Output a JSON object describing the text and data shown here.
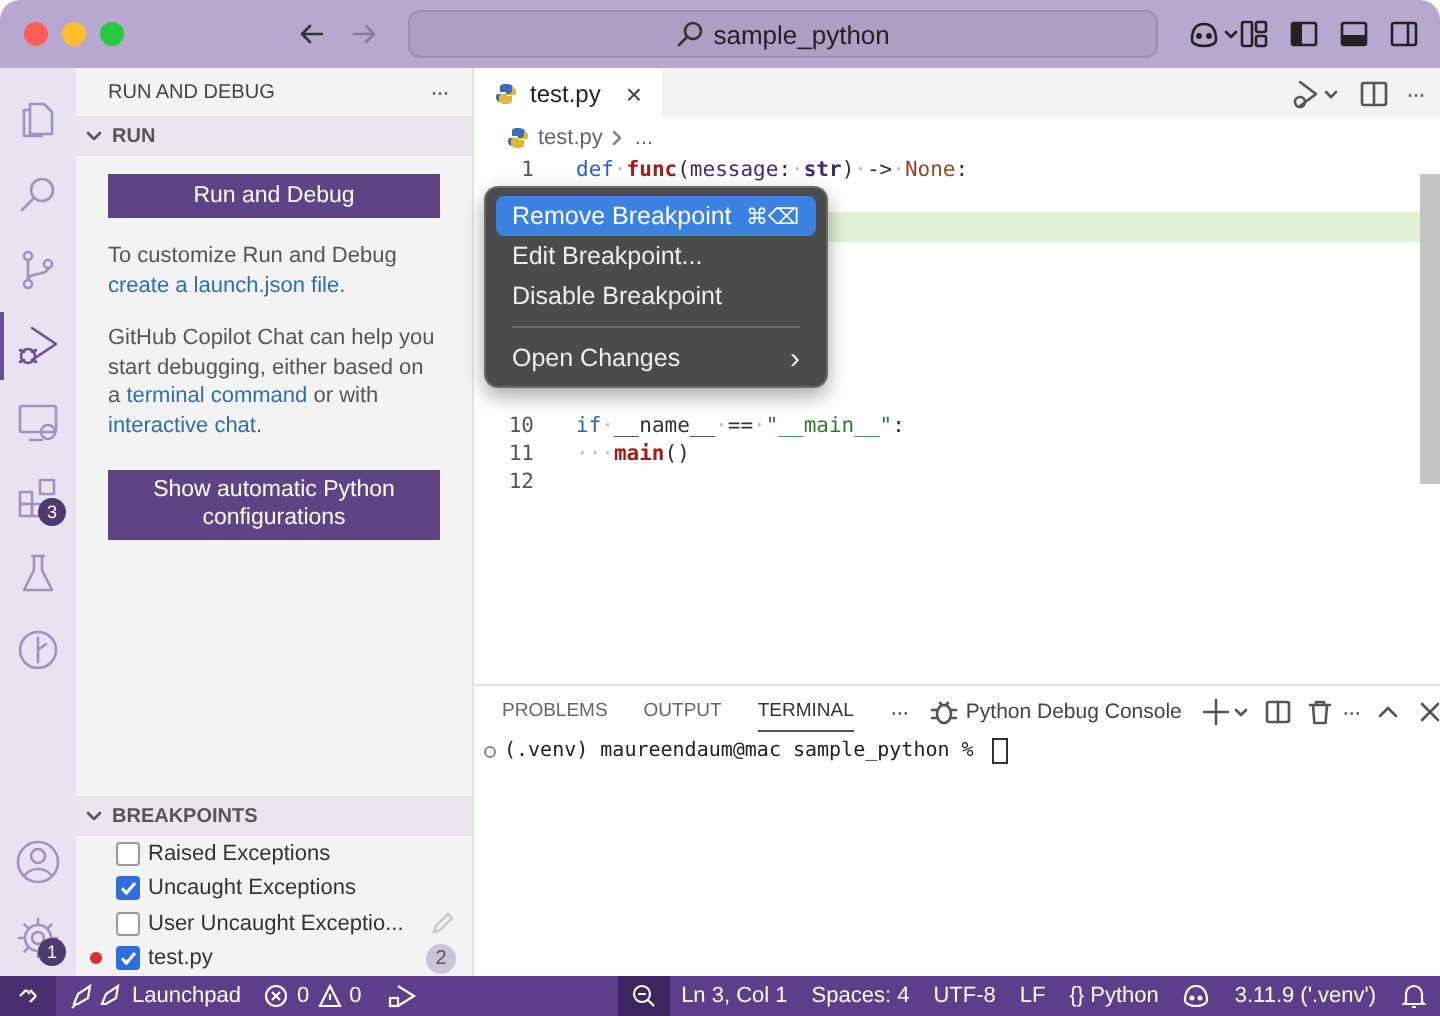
{
  "window": {
    "search": "sample_python"
  },
  "activity_bar": {
    "items": [
      {
        "kind": "files",
        "selected": false
      },
      {
        "kind": "search",
        "selected": false
      },
      {
        "kind": "source",
        "selected": false
      },
      {
        "kind": "debug",
        "selected": true
      },
      {
        "kind": "remote",
        "selected": false
      },
      {
        "kind": "extensions",
        "selected": false,
        "badge": "3"
      },
      {
        "kind": "testing",
        "selected": false
      },
      {
        "kind": "timeline",
        "selected": false
      }
    ],
    "bottom": [
      {
        "kind": "account"
      },
      {
        "kind": "settings",
        "badge": "1"
      }
    ]
  },
  "sidebar": {
    "title": "RUN AND DEBUG",
    "more": "···",
    "run_section": {
      "title": "RUN",
      "expanded": true,
      "button": "Run and Debug",
      "paragraphs": [
        [
          "To customize Run and Debug ",
          {
            "link": "create a launch.json file"
          },
          "."
        ],
        [
          "GitHub Copilot Chat can help you start debugging, either based on a ",
          {
            "link": "terminal command"
          },
          " or with ",
          {
            "link": "interactive chat"
          },
          "."
        ]
      ],
      "button2": "Show automatic Python configurations"
    },
    "breakpoints": {
      "title": "BREAKPOINTS",
      "expanded": true,
      "items": [
        {
          "label": "Raised Exceptions",
          "checked": false
        },
        {
          "label": "Uncaught Exceptions",
          "checked": true
        },
        {
          "label": "User Uncaught Exceptio...",
          "checked": false,
          "editable": true
        },
        {
          "label": "test.py",
          "checked": true,
          "breakpoint": true,
          "count": "2"
        }
      ]
    }
  },
  "editor": {
    "tabs": [
      {
        "label": "test.py",
        "selected": true,
        "close": "×"
      }
    ],
    "more": "···",
    "breadcrumb": [
      "test.py",
      "..."
    ],
    "lines": [
      {
        "kind": "code",
        "num": "1",
        "tokens": [
          {
            "kind": "kw",
            "text": "def"
          },
          {
            "kind": "ws",
            "text": "·"
          },
          {
            "kind": "fn",
            "text": "func"
          },
          {
            "kind": "pl",
            "text": "("
          },
          {
            "kind": "param",
            "text": "message"
          },
          {
            "kind": "pl",
            "text": ":"
          },
          {
            "kind": "ws",
            "text": "·"
          },
          {
            "kind": "type",
            "text": "str"
          },
          {
            "kind": "pl",
            "text": ")"
          },
          {
            "kind": "ws",
            "text": "·"
          },
          {
            "kind": "pl",
            "text": "->"
          },
          {
            "kind": "ws",
            "text": "·"
          },
          {
            "kind": "const",
            "text": "None"
          },
          {
            "kind": "pl",
            "text": ":"
          }
        ]
      },
      {
        "kind": "covered"
      },
      {
        "kind": "current"
      },
      {
        "kind": "covered"
      },
      {
        "kind": "covered"
      },
      {
        "kind": "covered"
      },
      {
        "kind": "covered"
      },
      {
        "kind": "covered"
      },
      {
        "kind": "covered"
      },
      {
        "kind": "code",
        "num": "10",
        "tokens": [
          {
            "kind": "kw",
            "text": "if"
          },
          {
            "kind": "ws",
            "text": "·"
          },
          {
            "kind": "pl",
            "text": "__name__"
          },
          {
            "kind": "ws",
            "text": "·"
          },
          {
            "kind": "pl",
            "text": "=="
          },
          {
            "kind": "ws",
            "text": "·"
          },
          {
            "kind": "str",
            "text": "\"__main__\""
          },
          {
            "kind": "pl",
            "text": ":"
          }
        ]
      },
      {
        "kind": "code",
        "num": "11",
        "tokens": [
          {
            "kind": "ws",
            "text": "···"
          },
          {
            "kind": "fn",
            "text": "main"
          },
          {
            "kind": "pl",
            "text": "()"
          }
        ]
      },
      {
        "kind": "code",
        "num": "12"
      }
    ],
    "context_menu": {
      "items": [
        {
          "kind": "item",
          "label": "Remove Breakpoint",
          "shortcut": "⌘⌫",
          "selected": true
        },
        {
          "kind": "item",
          "label": "Edit Breakpoint...",
          "selected": false
        },
        {
          "kind": "item",
          "label": "Disable Breakpoint",
          "selected": false
        },
        {
          "kind": "separator"
        },
        {
          "kind": "submenu",
          "label": "Open Changes",
          "arrow": "›",
          "selected": false
        }
      ]
    }
  },
  "panel": {
    "tabs": [
      {
        "label": "PROBLEMS",
        "selected": false
      },
      {
        "label": "OUTPUT",
        "selected": false
      },
      {
        "label": "TERMINAL",
        "selected": true
      }
    ],
    "more": "···",
    "terminal_name": "Python Debug Console",
    "actions_more": "···",
    "prompt": "(.venv) maureendaum@mac sample_python % "
  },
  "status_bar": {
    "launchpad": "Launchpad",
    "errors": "0",
    "warnings": "0",
    "right": [
      "Ln 3, Col 1",
      "Spaces: 4",
      "UTF-8",
      "LF",
      "{} Python"
    ],
    "python": "3.11.9 ('.venv')"
  }
}
